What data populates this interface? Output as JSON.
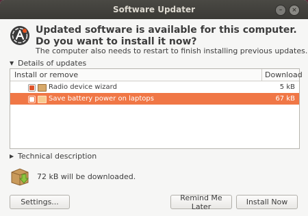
{
  "window": {
    "title": "Software Updater"
  },
  "header": {
    "headline": "Updated software is available for this computer. Do you want to install it now?",
    "subtext": "The computer also needs to restart to finish installing previous updates."
  },
  "details": {
    "expander_label": "Details of updates",
    "expanded": true,
    "columns": {
      "name": "Install or remove",
      "size": "Download"
    },
    "rows": [
      {
        "name": "Radio device wizard",
        "size": "5 kB",
        "checked": true,
        "selected": false
      },
      {
        "name": "Save battery power on laptops",
        "size": "67 kB",
        "checked": true,
        "selected": true
      }
    ]
  },
  "technical": {
    "expander_label": "Technical description",
    "expanded": false
  },
  "download": {
    "summary": "72 kB will be downloaded."
  },
  "buttons": {
    "settings": "Settings...",
    "remind": "Remind Me Later",
    "install": "Install Now"
  },
  "colors": {
    "selection": "#f07746",
    "titlebar": "#3b3a36"
  },
  "icons": {
    "app": "software-updater-icon",
    "package": "package-icon",
    "download": "download-package-icon"
  }
}
